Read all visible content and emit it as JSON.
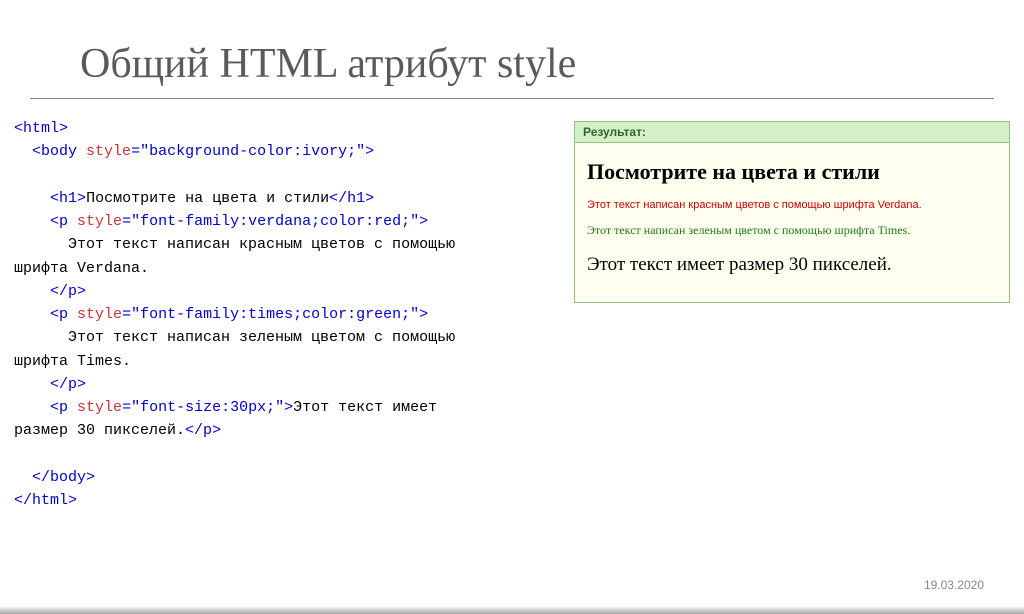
{
  "title": "Общий HTML атрибут style",
  "code": {
    "line1_open": "<",
    "line1_tag": "html",
    "line1_close": ">",
    "line2_open": "<",
    "line2_tag": "body",
    "line2_attr": " style",
    "line2_eq": "=\"background-color:ivory;\"",
    "line2_close": ">",
    "blank": "",
    "h1_open": "<",
    "h1_tag": "h1",
    "h1_gt": ">",
    "h1_text": "Посмотрите на цвета и стили",
    "h1_close_open": "</",
    "h1_close_tag": "h1",
    "h1_close_gt": ">",
    "p1_open": "<",
    "p1_tag": "p",
    "p1_attr": " style",
    "p1_eq": "=\"font-family:verdana;color:red;\"",
    "p1_gt": ">",
    "p1_text_a": "      Этот текст написан красным цветов с помощью",
    "p1_text_b": "шрифта Verdana.",
    "p_close_open": "</",
    "p_close_tag": "p",
    "p_close_gt": ">",
    "p2_open": "<",
    "p2_tag": "p",
    "p2_attr": " style",
    "p2_eq": "=\"font-family:times;color:green;\"",
    "p2_gt": ">",
    "p2_text_a": "      Этот текст написан зеленым цветом с помощью",
    "p2_text_b": "шрифта Times.",
    "p3_open": "<",
    "p3_tag": "p",
    "p3_attr": " style",
    "p3_eq": "=\"font-size:30px;\"",
    "p3_gt": ">",
    "p3_text_a": "Этот текст имеет",
    "p3_text_b": "размер 30 пикселей.",
    "body_close_open": "</",
    "body_close_tag": "body",
    "body_close_gt": ">",
    "html_close_open": "</",
    "html_close_tag": "html",
    "html_close_gt": ">"
  },
  "result": {
    "label": "Результат:",
    "h1": "Посмотрите на цвета и стили",
    "p1": "Этот текст написан красным цветов с помощью шрифта Verdana.",
    "p2": "Этот текст написан зеленым цветом с помощью шрифта Times.",
    "p3": "Этот текст имеет размер 30 пикселей."
  },
  "date": "19.03.2020"
}
